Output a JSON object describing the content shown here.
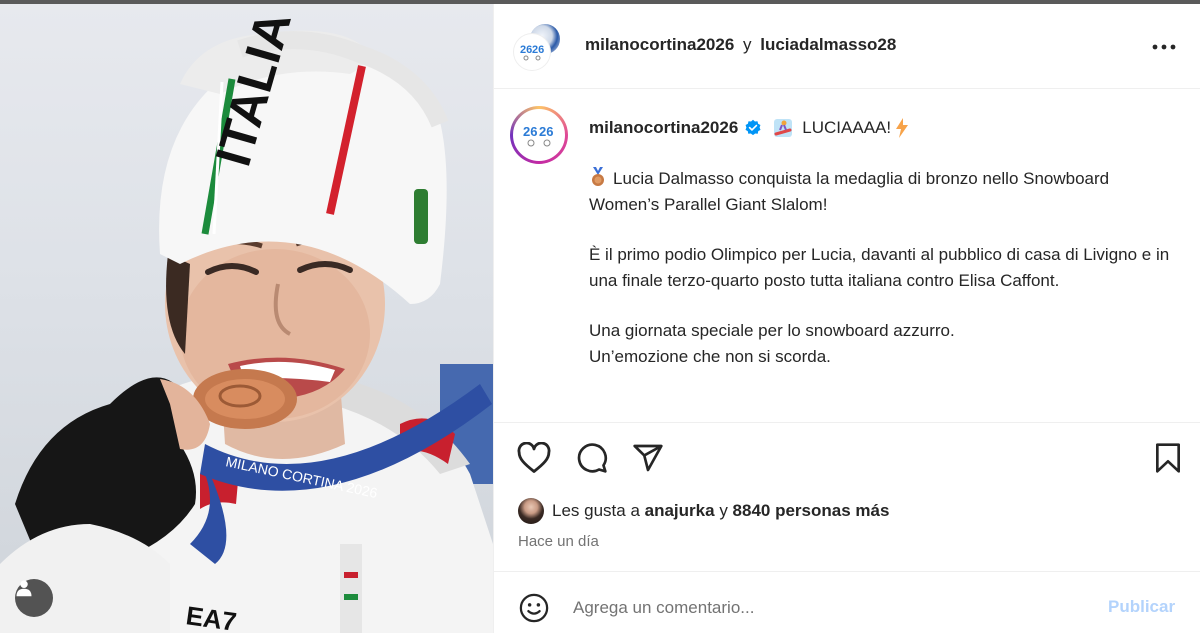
{
  "post": {
    "header": {
      "author": "milanocortina2026",
      "connector": "y",
      "collaborator": "luciadalmasso28"
    },
    "caption": {
      "user": "milanocortina2026",
      "title": "LUCIAAAA!",
      "paragraphs": [
        "Lucia Dalmasso conquista la medaglia di bronzo nello Snowboard Women’s Parallel Giant Slalom!",
        "È il primo podio Olimpico per Lucia, davanti al pubblico di casa di Livigno e in una finale terzo-quarto posto tutta italiana contro Elisa Caffont.",
        "Una giornata speciale per lo snowboard azzurro.",
        "Un’emozione che non si scorda."
      ]
    },
    "likes": {
      "prefix": "Les gusta a",
      "user": "anajurka",
      "connector": "y",
      "others": "8840 personas más"
    },
    "timestamp": "Hace un día",
    "comment": {
      "placeholder": "Agrega un comentario...",
      "submit_label": "Publicar"
    },
    "photo": {
      "hat_text": "ITALIA",
      "lanyard_text": "MILANO CORTINA 2026",
      "jacket_logo": "EA7"
    }
  },
  "colors": {
    "accent_blue": "#0095f6",
    "publish_disabled": "#b3d3fc",
    "secondary_text": "#737373",
    "divider": "#efefef"
  },
  "icons": [
    "more-options-icon",
    "verified-badge-icon",
    "heart-icon",
    "comment-icon",
    "share-icon",
    "bookmark-icon",
    "emoji-icon",
    "user-tag-icon"
  ]
}
